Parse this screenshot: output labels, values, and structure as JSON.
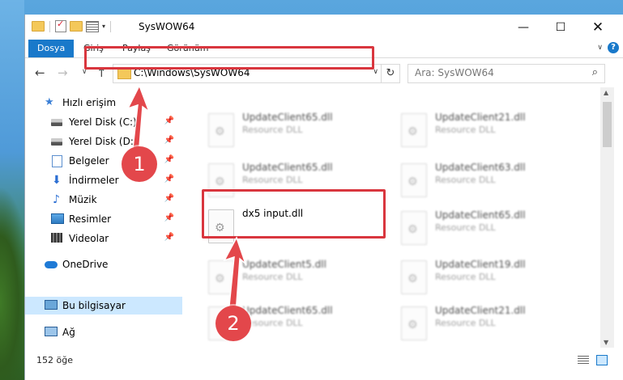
{
  "window": {
    "title": "SysWOW64",
    "minimize_glyph": "—",
    "maximize_glyph": "☐",
    "close_glyph": "✕"
  },
  "ribbon": {
    "tabs": [
      "Dosya",
      "Giriş",
      "Paylaş",
      "Görünüm"
    ],
    "help_glyph": "?",
    "expand_glyph": "∨"
  },
  "nav": {
    "back_glyph": "←",
    "forward_glyph": "→",
    "recent_glyph": "∨",
    "up_glyph": "↑",
    "address_path": "C:\\Windows\\SysWOW64",
    "address_dropdown_glyph": "∨",
    "refresh_glyph": "↻",
    "search_placeholder": "Ara: SysWOW64",
    "search_glyph": "⌕"
  },
  "sidebar": {
    "items": [
      {
        "label": "Hızlı erişim",
        "icon": "star-icon",
        "pinned": false
      },
      {
        "label": "Yerel Disk (C:)",
        "icon": "disk-icon",
        "pinned": true
      },
      {
        "label": "Yerel Disk (D:)",
        "icon": "disk-icon",
        "pinned": true
      },
      {
        "label": "Belgeler",
        "icon": "documents-icon",
        "pinned": true
      },
      {
        "label": "İndirmeler",
        "icon": "downloads-icon",
        "pinned": true
      },
      {
        "label": "Müzik",
        "icon": "music-icon",
        "pinned": true
      },
      {
        "label": "Resimler",
        "icon": "pictures-icon",
        "pinned": true
      },
      {
        "label": "Videolar",
        "icon": "videos-icon",
        "pinned": true
      },
      {
        "label": "OneDrive",
        "icon": "onedrive-icon",
        "pinned": false
      },
      {
        "label": "Bu bilgisayar",
        "icon": "computer-icon",
        "pinned": false,
        "selected": true
      },
      {
        "label": "Ağ",
        "icon": "network-icon",
        "pinned": false
      }
    ],
    "pin_glyph": "📌",
    "star_glyph": "★",
    "download_glyph": "⬇",
    "music_glyph": "♪"
  },
  "files": {
    "left_column": [
      {
        "name": "UpdateClient65.dll",
        "type": "Resource DLL"
      },
      {
        "name": "UpdateClient65.dll",
        "type": "Resource DLL"
      },
      {
        "name": "dx5 input.dll",
        "type": "",
        "highlighted": true
      },
      {
        "name": "UpdateClient5.dll",
        "type": "Resource DLL"
      },
      {
        "name": "UpdateClient65.dll",
        "type": "Resource DLL"
      }
    ],
    "right_column": [
      {
        "name": "UpdateClient21.dll",
        "type": "Resource DLL"
      },
      {
        "name": "UpdateClient63.dll",
        "type": "Resource DLL"
      },
      {
        "name": "UpdateClient65.dll",
        "type": "Resource DLL"
      },
      {
        "name": "UpdateClient19.dll",
        "type": "Resource DLL"
      },
      {
        "name": "UpdateClient21.dll",
        "type": "Resource DLL"
      }
    ]
  },
  "status": {
    "item_count": "152 öğe"
  },
  "scrollbar": {
    "up_glyph": "▲",
    "down_glyph": "▼"
  },
  "annotations": {
    "step1": "1",
    "step2": "2",
    "accent_color": "#e3474b"
  }
}
